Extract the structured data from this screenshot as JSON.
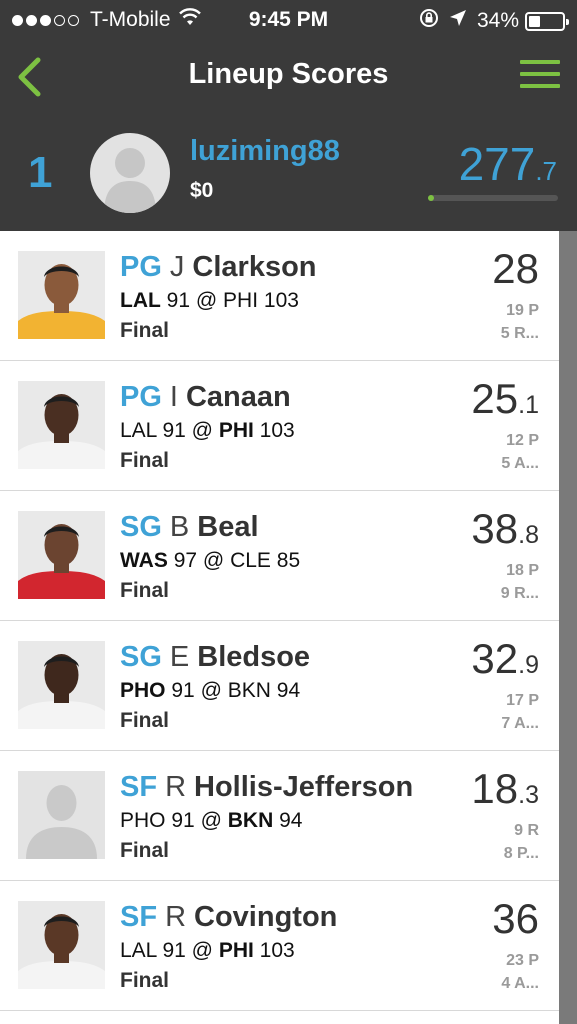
{
  "status_bar": {
    "carrier": "T-Mobile",
    "time": "9:45 PM",
    "battery": "34%",
    "battery_level": 0.34,
    "signal_dots": 3,
    "signal_total": 5
  },
  "nav": {
    "title": "Lineup Scores",
    "back_icon": "chevron-left-icon",
    "menu_icon": "hamburger-menu-icon"
  },
  "user": {
    "rank": "1",
    "username": "luziming88",
    "winnings": "$0",
    "score_int": "277",
    "score_dec": ".7",
    "progress": 0.03
  },
  "colors": {
    "header_bg": "#3a3a3a",
    "accent_blue": "#3fa2d6",
    "accent_green": "#7dc142"
  },
  "players": [
    {
      "pos": "PG",
      "initial": "J",
      "last": "Clarkson",
      "team1": "LAL",
      "score1": "91",
      "sep": "@",
      "team2": "PHI",
      "score2": "103",
      "winner": 1,
      "status": "Final",
      "pts_int": "28",
      "pts_dec": "",
      "stat1": "19 P",
      "stat2": "5 R...",
      "has_photo": true,
      "jersey": "#f2b332",
      "skin": "#8a5a3b"
    },
    {
      "pos": "PG",
      "initial": "I",
      "last": "Canaan",
      "team1": "LAL",
      "score1": "91",
      "sep": "@",
      "team2": "PHI",
      "score2": "103",
      "winner": 2,
      "status": "Final",
      "pts_int": "25",
      "pts_dec": ".1",
      "stat1": "12 P",
      "stat2": "5 A...",
      "has_photo": true,
      "jersey": "#f4f4f4",
      "skin": "#4a2f22"
    },
    {
      "pos": "SG",
      "initial": "B",
      "last": "Beal",
      "team1": "WAS",
      "score1": "97",
      "sep": "@",
      "team2": "CLE",
      "score2": "85",
      "winner": 1,
      "status": "Final",
      "pts_int": "38",
      "pts_dec": ".8",
      "stat1": "18 P",
      "stat2": "9 R...",
      "has_photo": true,
      "jersey": "#d2262f",
      "skin": "#6b4430"
    },
    {
      "pos": "SG",
      "initial": "E",
      "last": "Bledsoe",
      "team1": "PHO",
      "score1": "91",
      "sep": "@",
      "team2": "BKN",
      "score2": "94",
      "winner": 1,
      "status": "Final",
      "pts_int": "32",
      "pts_dec": ".9",
      "stat1": "17 P",
      "stat2": "7 A...",
      "has_photo": true,
      "jersey": "#f4f4f4",
      "skin": "#3f281d"
    },
    {
      "pos": "SF",
      "initial": "R",
      "last": "Hollis-Jefferson",
      "team1": "PHO",
      "score1": "91",
      "sep": "@",
      "team2": "BKN",
      "score2": "94",
      "winner": 2,
      "status": "Final",
      "pts_int": "18",
      "pts_dec": ".3",
      "stat1": "9 R",
      "stat2": "8 P...",
      "has_photo": false,
      "jersey": "#cccccc",
      "skin": "#cccccc"
    },
    {
      "pos": "SF",
      "initial": "R",
      "last": "Covington",
      "team1": "LAL",
      "score1": "91",
      "sep": "@",
      "team2": "PHI",
      "score2": "103",
      "winner": 2,
      "status": "Final",
      "pts_int": "36",
      "pts_dec": "",
      "stat1": "23 P",
      "stat2": "4 A...",
      "has_photo": true,
      "jersey": "#f4f4f4",
      "skin": "#5a3826"
    }
  ]
}
